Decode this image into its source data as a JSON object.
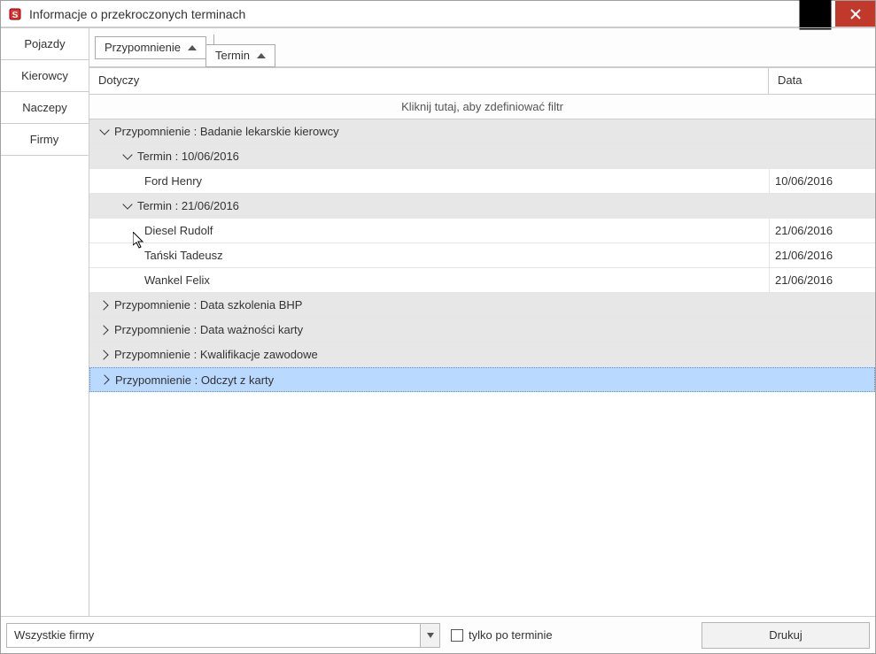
{
  "window": {
    "title": "Informacje o przekroczonych terminach"
  },
  "tabs": [
    {
      "label": "Pojazdy"
    },
    {
      "label": "Kierowcy"
    },
    {
      "label": "Naczepy"
    },
    {
      "label": "Firmy"
    }
  ],
  "group_by": [
    {
      "label": "Przypomnienie"
    },
    {
      "label": "Termin"
    }
  ],
  "columns": {
    "dotyczy": "Dotyczy",
    "data": "Data"
  },
  "filter_hint": "Kliknij tutaj, aby zdefiniować filtr",
  "groups": [
    {
      "label": "Przypomnienie : Badanie lekarskie kierowcy",
      "expanded": true,
      "subgroups": [
        {
          "label": "Termin : 10/06/2016",
          "expanded": true,
          "rows": [
            {
              "who": "Ford Henry",
              "date": "10/06/2016"
            }
          ]
        },
        {
          "label": "Termin : 21/06/2016",
          "expanded": true,
          "rows": [
            {
              "who": "Diesel Rudolf",
              "date": "21/06/2016"
            },
            {
              "who": "Tański Tadeusz",
              "date": "21/06/2016"
            },
            {
              "who": "Wankel Felix",
              "date": "21/06/2016"
            }
          ]
        }
      ]
    },
    {
      "label": "Przypomnienie : Data szkolenia BHP",
      "expanded": false
    },
    {
      "label": "Przypomnienie : Data ważności karty",
      "expanded": false
    },
    {
      "label": "Przypomnienie : Kwalifikacje zawodowe",
      "expanded": false
    },
    {
      "label": "Przypomnienie : Odczyt z karty",
      "expanded": false,
      "selected": true
    }
  ],
  "footer": {
    "combo_value": "Wszystkie firmy",
    "checkbox_label": "tylko po terminie",
    "print_label": "Drukuj"
  }
}
